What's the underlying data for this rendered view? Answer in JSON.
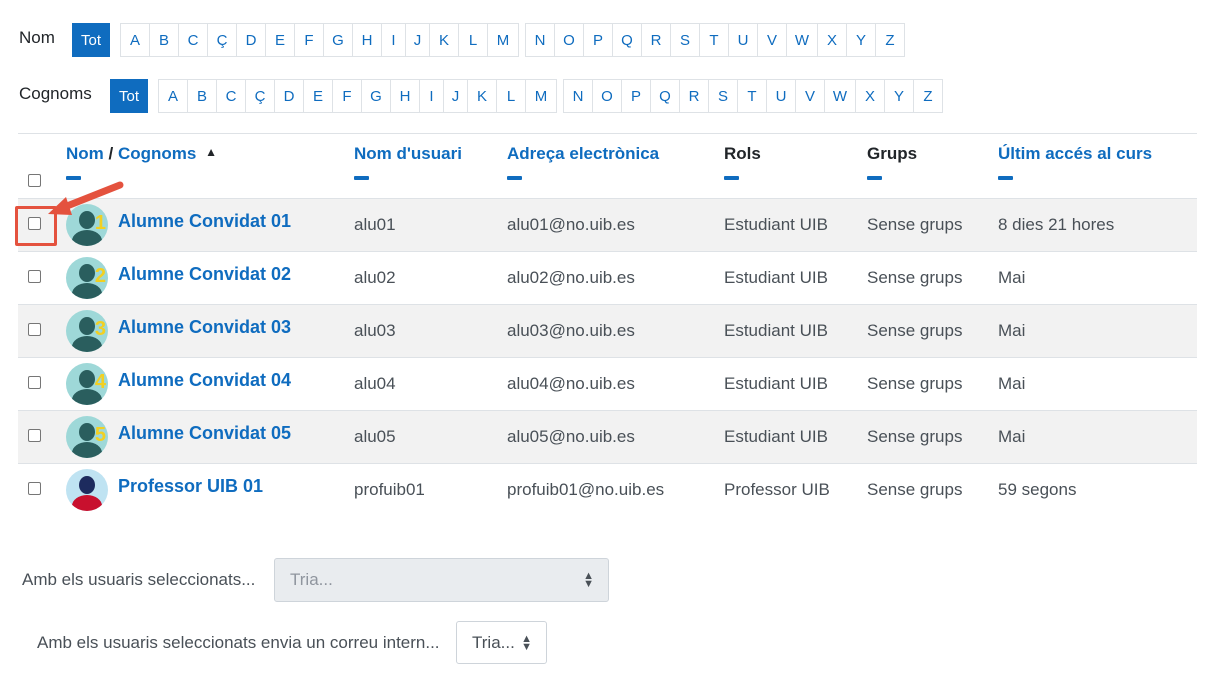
{
  "filters": {
    "first_name": {
      "label": "Nom",
      "all": "Tot",
      "groups": [
        [
          "A",
          "B",
          "C",
          "Ç",
          "D",
          "E",
          "F",
          "G",
          "H",
          "I",
          "J",
          "K",
          "L",
          "M"
        ],
        [
          "N",
          "O",
          "P",
          "Q",
          "R",
          "S",
          "T",
          "U",
          "V",
          "W",
          "X",
          "Y",
          "Z"
        ]
      ]
    },
    "last_name": {
      "label": "Cognoms",
      "all": "Tot",
      "groups": [
        [
          "A",
          "B",
          "C",
          "Ç",
          "D",
          "E",
          "F",
          "G",
          "H",
          "I",
          "J",
          "K",
          "L",
          "M"
        ],
        [
          "N",
          "O",
          "P",
          "Q",
          "R",
          "S",
          "T",
          "U",
          "V",
          "W",
          "X",
          "Y",
          "Z"
        ]
      ]
    }
  },
  "table": {
    "headers": {
      "name_first": "Nom",
      "name_sep": " / ",
      "name_last": "Cognoms",
      "sort_icon": "▲",
      "username": "Nom d'usuari",
      "email": "Adreça electrònica",
      "roles": "Rols",
      "groups": "Grups",
      "last_access": "Últim accés al curs"
    },
    "rows": [
      {
        "name": "Alumne Convidat 01",
        "avatar_num": "1",
        "username": "alu01",
        "email": "alu01@no.uib.es",
        "role": "Estudiant UIB",
        "groups": "Sense grups",
        "last_access": "8 dies 21 hores"
      },
      {
        "name": "Alumne Convidat 02",
        "avatar_num": "2",
        "username": "alu02",
        "email": "alu02@no.uib.es",
        "role": "Estudiant UIB",
        "groups": "Sense grups",
        "last_access": "Mai"
      },
      {
        "name": "Alumne Convidat 03",
        "avatar_num": "3",
        "username": "alu03",
        "email": "alu03@no.uib.es",
        "role": "Estudiant UIB",
        "groups": "Sense grups",
        "last_access": "Mai"
      },
      {
        "name": "Alumne Convidat 04",
        "avatar_num": "4",
        "username": "alu04",
        "email": "alu04@no.uib.es",
        "role": "Estudiant UIB",
        "groups": "Sense grups",
        "last_access": "Mai"
      },
      {
        "name": "Alumne Convidat 05",
        "avatar_num": "5",
        "username": "alu05",
        "email": "alu05@no.uib.es",
        "role": "Estudiant UIB",
        "groups": "Sense grups",
        "last_access": "Mai"
      },
      {
        "name": "Professor UIB 01",
        "avatar_num": "",
        "username": "profuib01",
        "email": "profuib01@no.uib.es",
        "role": "Professor UIB",
        "groups": "Sense grups",
        "last_access": "59 segons"
      }
    ]
  },
  "bulk": {
    "with_selected_label": "Amb els usuaris seleccionats...",
    "with_selected_placeholder": "Tria...",
    "message_label": "Amb els usuaris seleccionats envia un correu intern...",
    "message_placeholder": "Tria..."
  },
  "colors": {
    "accent": "#0f6cbf",
    "callout": "#e4523e"
  }
}
